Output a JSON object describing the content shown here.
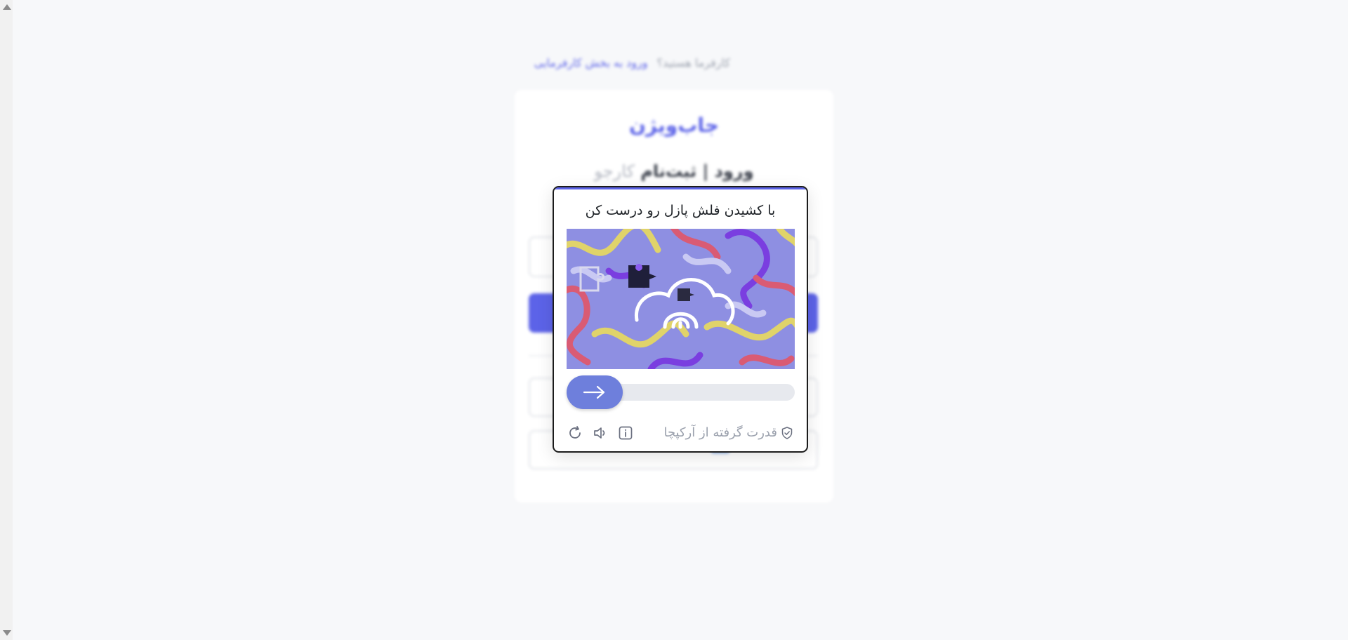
{
  "background_page": {
    "employer_prompt": "کارفرما هستید؟",
    "employer_link": "ورود به بخش کارفرمایی",
    "logo_text": "جاب‌ویژن",
    "title_main": "ورود | ثبت‌نام",
    "title_muted": "کارجو"
  },
  "captcha": {
    "instruction": "با کشیدن فلش پازل رو درست کن",
    "powered_by": "قدرت گرفته از آرکپچا",
    "slider_progress": 0
  },
  "colors": {
    "brand": "#5c63e8",
    "slider_thumb": "#6e7fdc",
    "puzzle_bg": "#8d8ee0"
  },
  "icons": {
    "slider": "arrow-right-icon",
    "refresh": "refresh-icon",
    "audio": "speaker-icon",
    "info": "info-icon",
    "shield": "shield-check-icon"
  }
}
